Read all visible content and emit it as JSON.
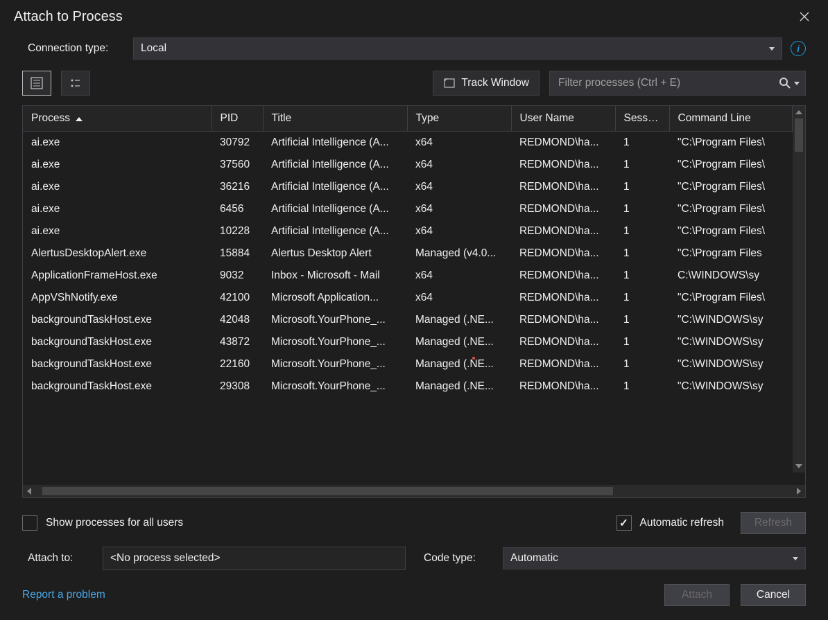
{
  "window": {
    "title": "Attach to Process"
  },
  "connection": {
    "label": "Connection type:",
    "value": "Local"
  },
  "toolbar": {
    "track_window": "Track Window",
    "filter_placeholder": "Filter processes (Ctrl + E)"
  },
  "columns": {
    "process": "Process",
    "pid": "PID",
    "title": "Title",
    "type": "Type",
    "user": "User Name",
    "session": "Session",
    "cmd": "Command Line"
  },
  "rows": [
    {
      "process": "ai.exe",
      "pid": "30792",
      "title": "Artificial Intelligence (A...",
      "type": "x64",
      "user": "REDMOND\\ha...",
      "session": "1",
      "cmd": "\"C:\\Program Files\\"
    },
    {
      "process": "ai.exe",
      "pid": "37560",
      "title": "Artificial Intelligence (A...",
      "type": "x64",
      "user": "REDMOND\\ha...",
      "session": "1",
      "cmd": "\"C:\\Program Files\\"
    },
    {
      "process": "ai.exe",
      "pid": "36216",
      "title": "Artificial Intelligence (A...",
      "type": "x64",
      "user": "REDMOND\\ha...",
      "session": "1",
      "cmd": "\"C:\\Program Files\\"
    },
    {
      "process": "ai.exe",
      "pid": "6456",
      "title": "Artificial Intelligence (A...",
      "type": "x64",
      "user": "REDMOND\\ha...",
      "session": "1",
      "cmd": "\"C:\\Program Files\\"
    },
    {
      "process": "ai.exe",
      "pid": "10228",
      "title": "Artificial Intelligence (A...",
      "type": "x64",
      "user": "REDMOND\\ha...",
      "session": "1",
      "cmd": "\"C:\\Program Files\\"
    },
    {
      "process": "AlertusDesktopAlert.exe",
      "pid": "15884",
      "title": "Alertus Desktop Alert",
      "type": "Managed (v4.0...",
      "user": "REDMOND\\ha...",
      "session": "1",
      "cmd": "\"C:\\Program Files"
    },
    {
      "process": "ApplicationFrameHost.exe",
      "pid": "9032",
      "title": "Inbox - Microsoft - Mail",
      "type": "x64",
      "user": "REDMOND\\ha...",
      "session": "1",
      "cmd": "C:\\WINDOWS\\sy"
    },
    {
      "process": "AppVShNotify.exe",
      "pid": "42100",
      "title": "Microsoft Application...",
      "type": "x64",
      "user": "REDMOND\\ha...",
      "session": "1",
      "cmd": "\"C:\\Program Files\\"
    },
    {
      "process": "backgroundTaskHost.exe",
      "pid": "42048",
      "title": "Microsoft.YourPhone_...",
      "type": "Managed (.NE...",
      "user": "REDMOND\\ha...",
      "session": "1",
      "cmd": "\"C:\\WINDOWS\\sy"
    },
    {
      "process": "backgroundTaskHost.exe",
      "pid": "43872",
      "title": "Microsoft.YourPhone_...",
      "type": "Managed (.NE...",
      "user": "REDMOND\\ha...",
      "session": "1",
      "cmd": "\"C:\\WINDOWS\\sy"
    },
    {
      "process": "backgroundTaskHost.exe",
      "pid": "22160",
      "title": "Microsoft.YourPhone_...",
      "type": "Managed (.NE...",
      "user": "REDMOND\\ha...",
      "session": "1",
      "cmd": "\"C:\\WINDOWS\\sy"
    },
    {
      "process": "backgroundTaskHost.exe",
      "pid": "29308",
      "title": "Microsoft.YourPhone_...",
      "type": "Managed (.NE...",
      "user": "REDMOND\\ha...",
      "session": "1",
      "cmd": "\"C:\\WINDOWS\\sy"
    }
  ],
  "options": {
    "show_all_users": "Show processes for all users",
    "auto_refresh": "Automatic refresh",
    "refresh": "Refresh"
  },
  "attach_to": {
    "label": "Attach to:",
    "value": "<No process selected>"
  },
  "code_type": {
    "label": "Code type:",
    "value": "Automatic"
  },
  "footer": {
    "report": "Report a problem",
    "attach": "Attach",
    "cancel": "Cancel"
  }
}
